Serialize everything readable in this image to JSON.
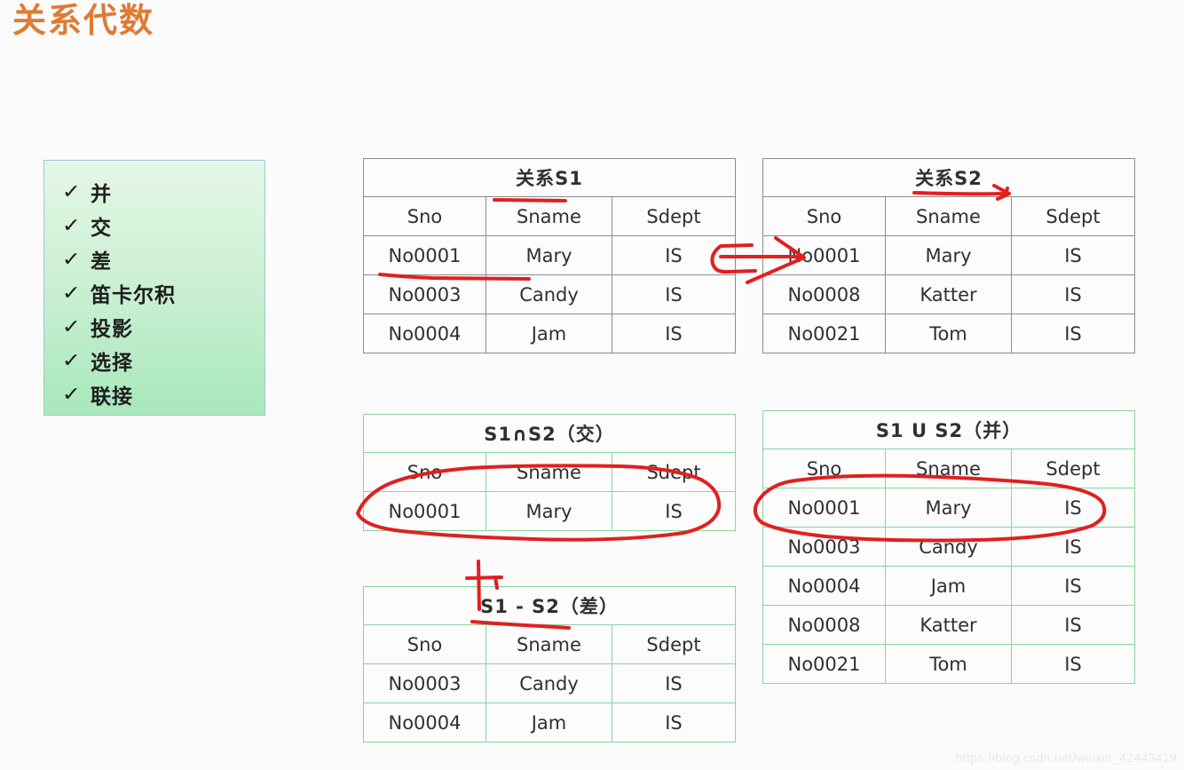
{
  "slide": {
    "title": "关系代数",
    "title_color": "#e07b33",
    "background": "#fbfbfb"
  },
  "feature_box": {
    "border_color": "#9ec8d6",
    "gradient_from": "#e4f7e6",
    "gradient_to": "#a8e8bb",
    "check_glyph": "✓",
    "items": [
      {
        "label": "并"
      },
      {
        "label": "交"
      },
      {
        "label": "差"
      },
      {
        "label": "笛卡尔积"
      },
      {
        "label": "投影"
      },
      {
        "label": "选择"
      },
      {
        "label": "联接"
      }
    ]
  },
  "tables": {
    "s1": {
      "caption": "关系S1",
      "border_color": "#8c8c8c",
      "headers": [
        "Sno",
        "Sname",
        "Sdept"
      ],
      "rows": [
        [
          "No0001",
          "Mary",
          "IS"
        ],
        [
          "No0003",
          "Candy",
          "IS"
        ],
        [
          "No0004",
          "Jam",
          "IS"
        ]
      ]
    },
    "s2": {
      "caption": "关系S2",
      "border_color": "#8c8c8c",
      "headers": [
        "Sno",
        "Sname",
        "Sdept"
      ],
      "rows": [
        [
          "No0001",
          "Mary",
          "IS"
        ],
        [
          "No0008",
          "Katter",
          "IS"
        ],
        [
          "No0021",
          "Tom",
          "IS"
        ]
      ]
    },
    "intersection": {
      "caption": "S1∩S2（交）",
      "border_color": "#8ad49d",
      "headers": [
        "Sno",
        "Sname",
        "Sdept"
      ],
      "rows": [
        [
          "No0001",
          "Mary",
          "IS"
        ]
      ]
    },
    "difference": {
      "caption": "S1 - S2（差）",
      "border_color": "#8ad49d",
      "headers": [
        "Sno",
        "Sname",
        "Sdept"
      ],
      "rows": [
        [
          "No0003",
          "Candy",
          "IS"
        ],
        [
          "No0004",
          "Jam",
          "IS"
        ]
      ]
    },
    "union": {
      "caption": "S1 U S2（并）",
      "border_color": "#8ad49d",
      "headers": [
        "Sno",
        "Sname",
        "Sdept"
      ],
      "rows": [
        [
          "No0001",
          "Mary",
          "IS"
        ],
        [
          "No0003",
          "Candy",
          "IS"
        ],
        [
          "No0004",
          "Jam",
          "IS"
        ],
        [
          "No0008",
          "Katter",
          "IS"
        ],
        [
          "No0021",
          "Tom",
          "IS"
        ]
      ]
    }
  },
  "annotations": {
    "ink_color": "#e02020",
    "marks": [
      {
        "name": "underline-sname-s1",
        "kind": "underline"
      },
      {
        "name": "underline-no0001-s1",
        "kind": "underline"
      },
      {
        "name": "underline-caption-s2",
        "kind": "underline"
      },
      {
        "name": "arrow-s1-to-s2",
        "kind": "arrow"
      },
      {
        "name": "ellipse-intersection-row",
        "kind": "ellipse"
      },
      {
        "name": "ellipse-union-row",
        "kind": "ellipse"
      },
      {
        "name": "underline-difference-caption",
        "kind": "underline"
      },
      {
        "name": "tick-above-difference-caption",
        "kind": "tick"
      }
    ]
  },
  "watermark": {
    "text": "https://blog.csdn.net/weixin_42443419"
  }
}
